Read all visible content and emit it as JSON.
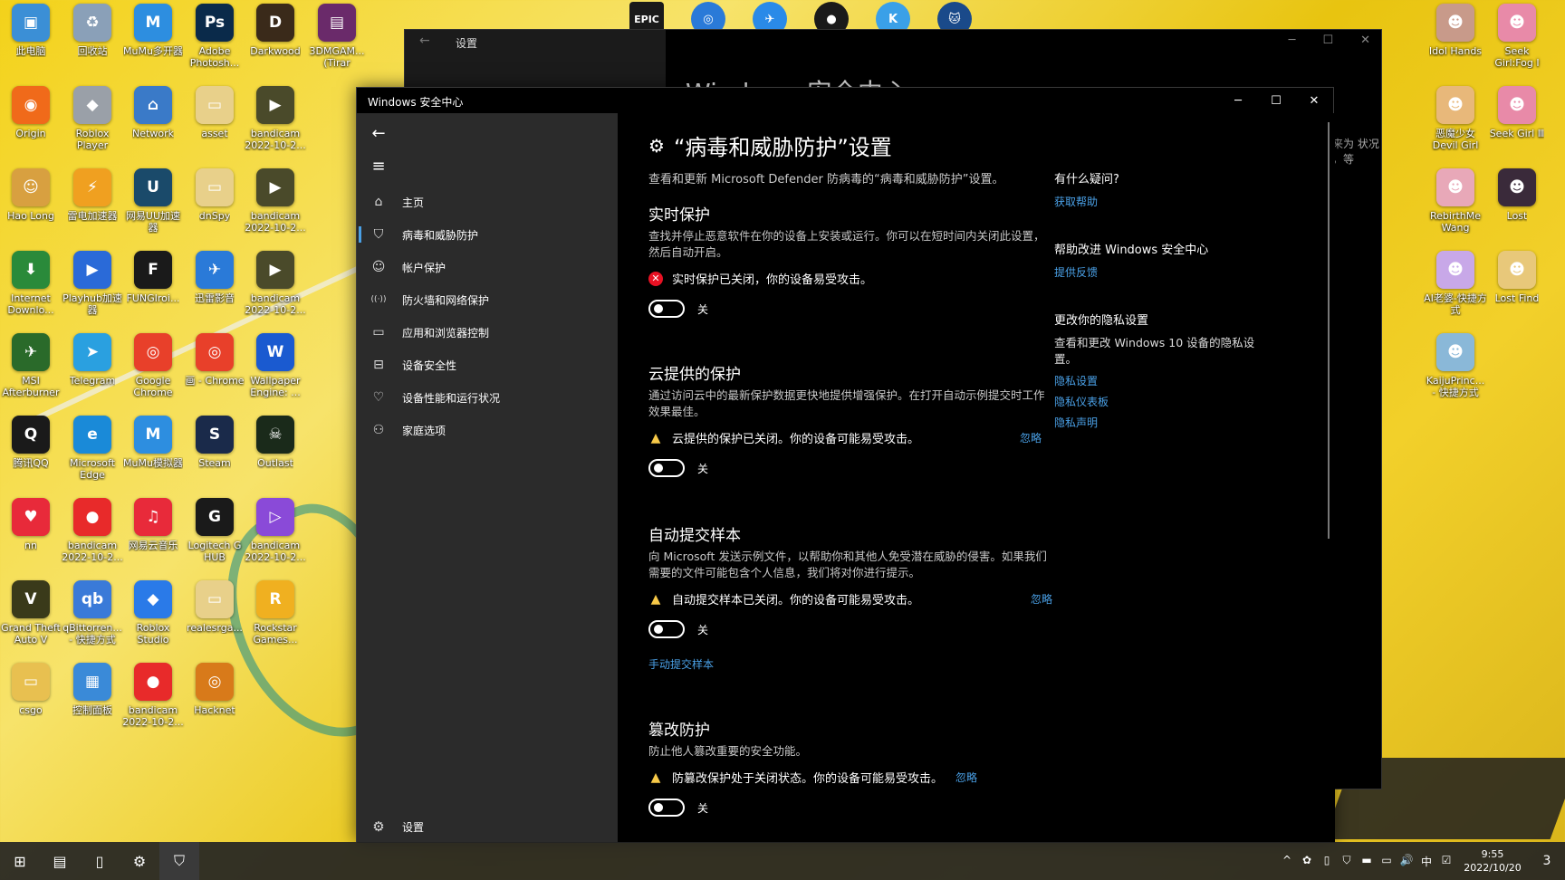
{
  "desktop": {
    "icons_left": [
      {
        "label": "此电脑",
        "icon": "computer-icon",
        "color": "#3b8fd6",
        "glyph": "▣"
      },
      {
        "label": "回收站",
        "icon": "recycle-bin-icon",
        "color": "#8aa0b8",
        "glyph": "♻"
      },
      {
        "label": "MuMu多开器",
        "icon": "mumu-icon",
        "color": "#2d8ee0",
        "glyph": "M"
      },
      {
        "label": "Adobe Photosh...",
        "icon": "photoshop-icon",
        "color": "#0a2a4a",
        "glyph": "Ps"
      },
      {
        "label": "Darkwood",
        "icon": "darkwood-icon",
        "color": "#3a2a1a",
        "glyph": "D"
      },
      {
        "label": "3DMGAM... (Tirar",
        "icon": "archive-icon",
        "color": "#6a2a6a",
        "glyph": "▤"
      },
      {
        "label": "Origin",
        "icon": "origin-icon",
        "color": "#f06a1a",
        "glyph": "◉"
      },
      {
        "label": "Roblox Player",
        "icon": "roblox-icon",
        "color": "#9aa0a8",
        "glyph": "◆"
      },
      {
        "label": "Network",
        "icon": "network-icon",
        "color": "#3a7ac8",
        "glyph": "⌂"
      },
      {
        "label": "asset",
        "icon": "folder-icon",
        "color": "#e8d08a",
        "glyph": "▭"
      },
      {
        "label": "bandicam 2022-10-2...",
        "icon": "video-file-icon",
        "color": "#4a4a2a",
        "glyph": "▶"
      },
      {
        "label": "Hao Long",
        "icon": "user-folder-icon",
        "color": "#d8a040",
        "glyph": "☺"
      },
      {
        "label": "雷电加速器",
        "icon": "accelerator-icon",
        "color": "#f0a020",
        "glyph": "⚡"
      },
      {
        "label": "网易UU加速器",
        "icon": "uu-icon",
        "color": "#1a4a6a",
        "glyph": "U"
      },
      {
        "label": "dnSpy",
        "icon": "folder-icon",
        "color": "#e8d08a",
        "glyph": "▭"
      },
      {
        "label": "bandicam 2022-10-2...",
        "icon": "video-file-icon",
        "color": "#4a4a2a",
        "glyph": "▶"
      },
      {
        "label": "Internet Downlo...",
        "icon": "idm-icon",
        "color": "#2a8a3a",
        "glyph": "⬇"
      },
      {
        "label": "Playhub加速器",
        "icon": "playhub-icon",
        "color": "#2a6ad8",
        "glyph": "▶"
      },
      {
        "label": "FUNGIroi...",
        "icon": "fungi-icon",
        "color": "#1a1a1a",
        "glyph": "F"
      },
      {
        "label": "迅雷影音",
        "icon": "player-icon",
        "color": "#2a7ad8",
        "glyph": "✈"
      },
      {
        "label": "bandicam 2022-10-2...",
        "icon": "video-file-icon",
        "color": "#4a4a2a",
        "glyph": "▶"
      },
      {
        "label": "MSI Afterburner",
        "icon": "msi-icon",
        "color": "#2a6a2a",
        "glyph": "✈"
      },
      {
        "label": "Telegram",
        "icon": "telegram-icon",
        "color": "#2aa0e0",
        "glyph": "➤"
      },
      {
        "label": "Google Chrome",
        "icon": "chrome-icon",
        "color": "#e8402a",
        "glyph": "◎"
      },
      {
        "label": "画 - Chrome",
        "icon": "chrome-icon",
        "color": "#e8402a",
        "glyph": "◎"
      },
      {
        "label": "Wallpaper Engine: ...",
        "icon": "wallpaper-engine-icon",
        "color": "#1a5ad0",
        "glyph": "W"
      },
      {
        "label": "腾讯QQ",
        "icon": "qq-icon",
        "color": "#1a1a1a",
        "glyph": "Q"
      },
      {
        "label": "Microsoft Edge",
        "icon": "edge-icon",
        "color": "#1a8ad8",
        "glyph": "e"
      },
      {
        "label": "MuMu模拟器",
        "icon": "mumu-icon",
        "color": "#2d8ee0",
        "glyph": "M"
      },
      {
        "label": "Steam",
        "icon": "steam-icon",
        "color": "#1a2a4a",
        "glyph": "S"
      },
      {
        "label": "Outlast",
        "icon": "outlast-icon",
        "color": "#1a2a1a",
        "glyph": "☠"
      },
      {
        "label": "nn",
        "icon": "nn-icon",
        "color": "#e82a3a",
        "glyph": "♥"
      },
      {
        "label": "bandicam 2022-10-2...",
        "icon": "bandicam-icon",
        "color": "#e82a2a",
        "glyph": "●"
      },
      {
        "label": "网易云音乐",
        "icon": "netease-music-icon",
        "color": "#e82a3a",
        "glyph": "♫"
      },
      {
        "label": "Logitech G HUB",
        "icon": "logitech-icon",
        "color": "#1a1a1a",
        "glyph": "G"
      },
      {
        "label": "bandicam 2022-10-2...",
        "icon": "mp4-icon",
        "color": "#8a4ad8",
        "glyph": "▷"
      },
      {
        "label": "Grand Theft Auto V",
        "icon": "gta-icon",
        "color": "#3a3a1a",
        "glyph": "V"
      },
      {
        "label": "qBittorren... - 快捷方式",
        "icon": "qbittorrent-icon",
        "color": "#3a7ad8",
        "glyph": "qb"
      },
      {
        "label": "Roblox Studio",
        "icon": "roblox-studio-icon",
        "color": "#2a7ae8",
        "glyph": "◆"
      },
      {
        "label": "realesrga...",
        "icon": "folder-icon",
        "color": "#e8d08a",
        "glyph": "▭"
      },
      {
        "label": "Rockstar Games...",
        "icon": "rockstar-icon",
        "color": "#f0b020",
        "glyph": "R"
      },
      {
        "label": "csgo",
        "icon": "folder-icon",
        "color": "#e8c050",
        "glyph": "▭"
      },
      {
        "label": "控制面板",
        "icon": "control-panel-icon",
        "color": "#3a8ad8",
        "glyph": "▦"
      },
      {
        "label": "bandicam 2022-10-2...",
        "icon": "bandicam-icon",
        "color": "#e82a2a",
        "glyph": "●"
      },
      {
        "label": "Hacknet",
        "icon": "hacknet-icon",
        "color": "#d87a1a",
        "glyph": "◎"
      }
    ],
    "icons_right": [
      {
        "label": "Idol Hands",
        "icon": "anime-icon",
        "color": "#c89a8a",
        "glyph": "☻"
      },
      {
        "label": "Seek Girl:Fog Ⅰ",
        "icon": "anime-icon",
        "color": "#e88aa8",
        "glyph": "☻"
      },
      {
        "label": "恶魔少女 Devil Girl",
        "icon": "anime-icon",
        "color": "#e8b87a",
        "glyph": "☻"
      },
      {
        "label": "Seek Girl Ⅲ",
        "icon": "anime-icon",
        "color": "#e88aa8",
        "glyph": "☻"
      },
      {
        "label": "RebirthMe Wang",
        "icon": "anime-icon",
        "color": "#e8a8b8",
        "glyph": "☻"
      },
      {
        "label": "Lost",
        "icon": "anime-icon",
        "color": "#3a2a3a",
        "glyph": "☻"
      },
      {
        "label": "AI老婆-快捷方式",
        "icon": "anime-icon",
        "color": "#c8a8e8",
        "glyph": "☻"
      },
      {
        "label": "Lost Find",
        "icon": "anime-icon",
        "color": "#e8c87a",
        "glyph": "☻"
      },
      {
        "label": "KaijuPrinc... - 快捷方式",
        "icon": "anime-icon",
        "color": "#8ab8d8",
        "glyph": "☻"
      }
    ],
    "top_dock": [
      {
        "icon": "epic-games-icon",
        "color": "#1a1a1a",
        "glyph": "EPIC"
      },
      {
        "icon": "safari-like-icon",
        "color": "#2a7ad8",
        "glyph": "◎"
      },
      {
        "icon": "feishu-icon",
        "color": "#2a8ae8",
        "glyph": "✈"
      },
      {
        "icon": "record-icon",
        "color": "#1a1a1a",
        "glyph": "●"
      },
      {
        "icon": "k-app-icon",
        "color": "#3aa0e8",
        "glyph": "K"
      },
      {
        "icon": "cat-icon",
        "color": "#1a4a8a",
        "glyph": "🐱"
      }
    ]
  },
  "bg_window": {
    "title": "设置",
    "heading": "Windows 安全中心",
    "fragment": "来为 状况 ，等"
  },
  "window": {
    "title": "Windows 安全中心",
    "minimize": "─",
    "maximize": "☐",
    "close": "✕"
  },
  "sidebar": {
    "back_glyph": "←",
    "menu_glyph": "≡",
    "items": [
      {
        "label": "主页",
        "icon": "home-icon",
        "glyph": "⌂"
      },
      {
        "label": "病毒和威胁防护",
        "icon": "shield-icon",
        "glyph": "⛉"
      },
      {
        "label": "帐户保护",
        "icon": "person-icon",
        "glyph": "☺"
      },
      {
        "label": "防火墙和网络保护",
        "icon": "wifi-icon",
        "glyph": "((·))"
      },
      {
        "label": "应用和浏览器控制",
        "icon": "app-window-icon",
        "glyph": "▭"
      },
      {
        "label": "设备安全性",
        "icon": "laptop-icon",
        "glyph": "⊟"
      },
      {
        "label": "设备性能和运行状况",
        "icon": "heart-icon",
        "glyph": "♡"
      },
      {
        "label": "家庭选项",
        "icon": "family-icon",
        "glyph": "⚇"
      }
    ],
    "settings_label": "设置",
    "settings_glyph": "⚙"
  },
  "content": {
    "title": "“病毒和威胁防护”设置",
    "subtitle": "查看和更新 Microsoft Defender 防病毒的“病毒和威胁防护”设置。",
    "sections": [
      {
        "heading": "实时保护",
        "desc": "查找并停止恶意软件在你的设备上安装或运行。你可以在短时间内关闭此设置，然后自动开启。",
        "status": "实时保护已关闭，你的设备易受攻击。",
        "status_type": "err",
        "dismiss": "",
        "toggle_label": "关"
      },
      {
        "heading": "云提供的保护",
        "desc": "通过访问云中的最新保护数据更快地提供增强保护。在打开自动示例提交时工作效果最佳。",
        "status": "云提供的保护已关闭。你的设备可能易受攻击。",
        "status_type": "warn",
        "dismiss": "忽略",
        "toggle_label": "关"
      },
      {
        "heading": "自动提交样本",
        "desc": "向 Microsoft 发送示例文件，以帮助你和其他人免受潜在威胁的侵害。如果我们需要的文件可能包含个人信息，我们将对你进行提示。",
        "status": "自动提交样本已关闭。你的设备可能易受攻击。",
        "status_type": "warn",
        "dismiss": "忽略",
        "toggle_label": "关",
        "link": "手动提交样本"
      },
      {
        "heading": "篡改防护",
        "desc": "防止他人篡改重要的安全功能。",
        "status": "防篡改保护处于关闭状态。你的设备可能易受攻击。",
        "status_type": "warn",
        "dismiss": "忽略",
        "toggle_label": "关"
      }
    ],
    "right": {
      "q_head": "有什么疑问?",
      "q_link": "获取帮助",
      "improve_head": "帮助改进 Windows 安全中心",
      "improve_link": "提供反馈",
      "privacy_head": "更改你的隐私设置",
      "privacy_text": "查看和更改 Windows 10 设备的隐私设置。",
      "privacy_links": [
        "隐私设置",
        "隐私仪表板",
        "隐私声明"
      ]
    }
  },
  "taskbar": {
    "items": [
      {
        "icon": "start-icon",
        "glyph": "⊞"
      },
      {
        "icon": "explorer-icon",
        "glyph": "▤"
      },
      {
        "icon": "phone-icon",
        "glyph": "▯"
      },
      {
        "icon": "settings-icon",
        "glyph": "⚙"
      },
      {
        "icon": "defender-icon",
        "glyph": "⛉"
      }
    ],
    "tray": [
      "^",
      "✿",
      "▯",
      "⛉",
      "▬",
      "▭",
      "🔊",
      "中",
      "☑"
    ],
    "time": "9:55",
    "date": "2022/10/20",
    "notif_count": "3"
  },
  "colors": {
    "accent": "#4aa0e6",
    "error": "#e81123",
    "warning": "#f7c948",
    "sidebar_bg": "#2b2b2b",
    "content_bg": "#000000"
  }
}
